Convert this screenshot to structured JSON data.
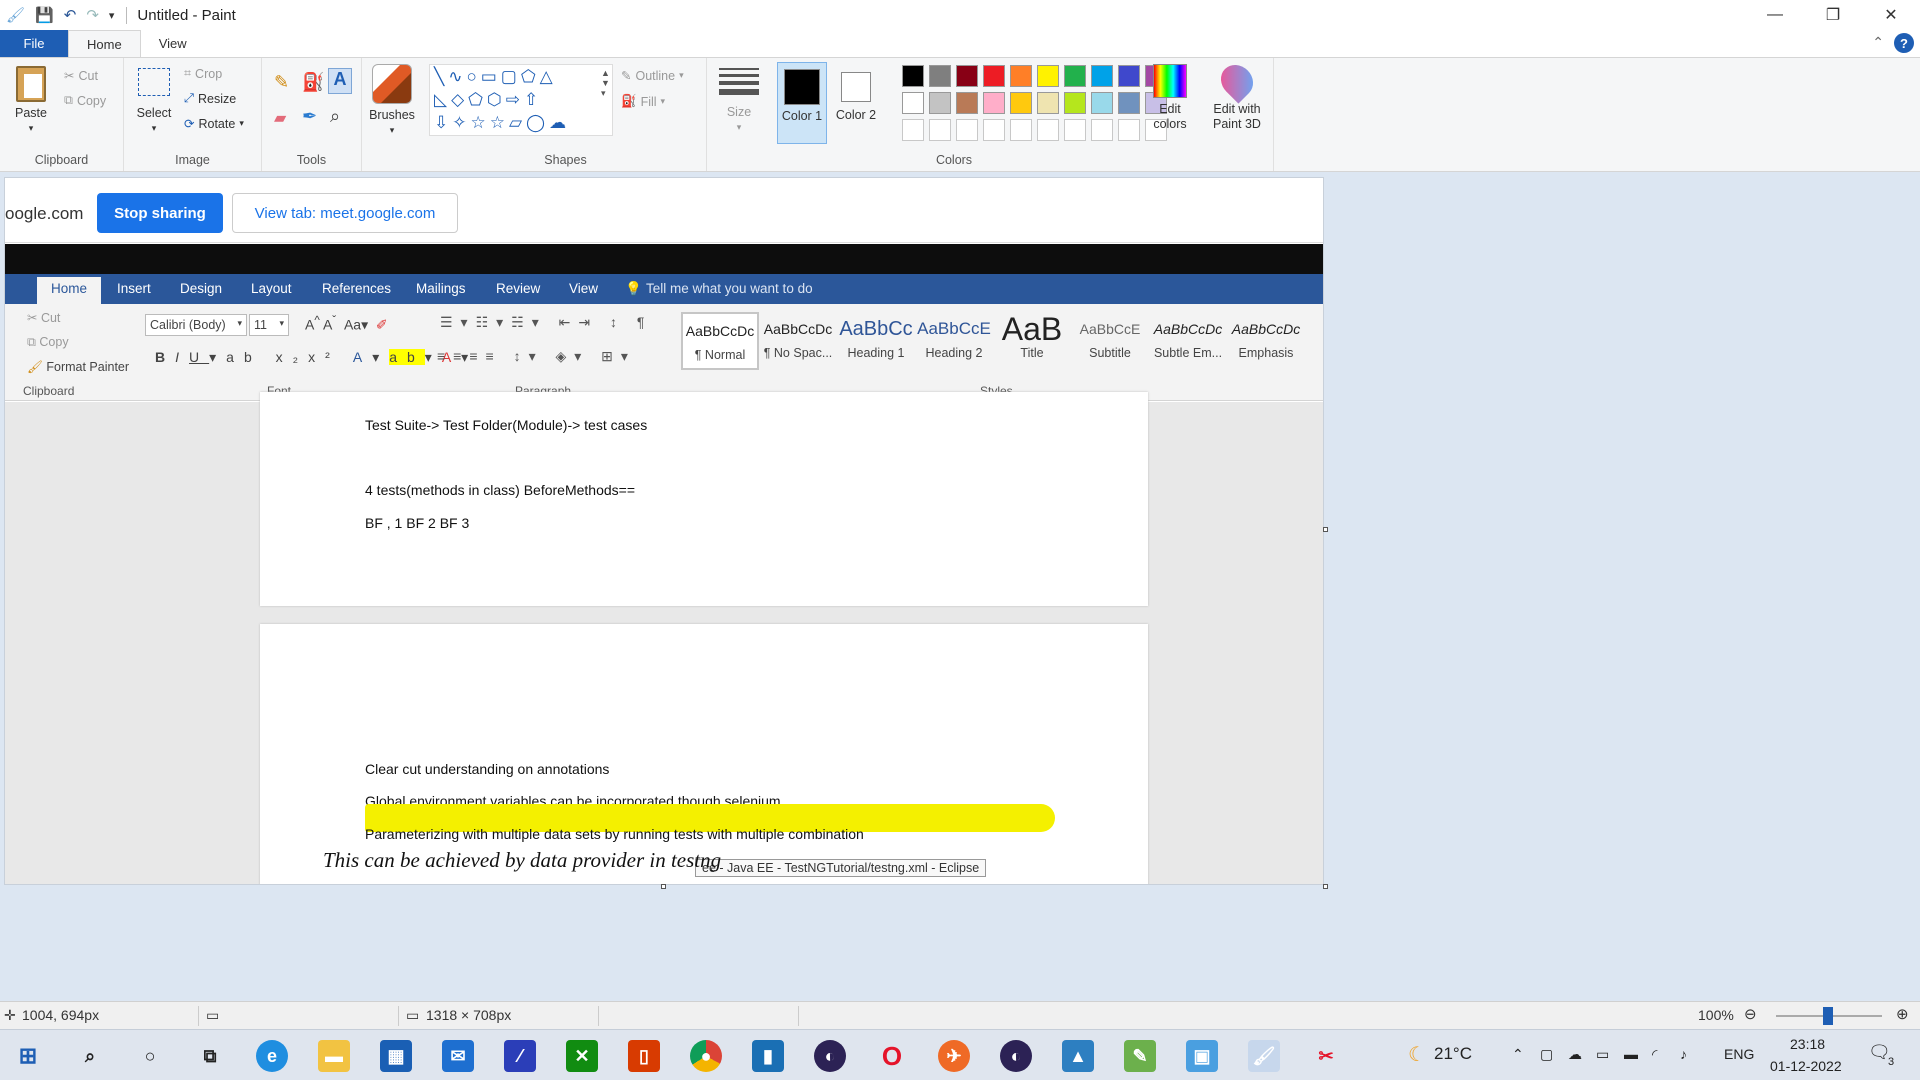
{
  "window": {
    "title": "Untitled - Paint",
    "minimize": "—",
    "restore": "❐",
    "close": "✕"
  },
  "menu": {
    "file": "File",
    "tabs": [
      "Home",
      "View"
    ],
    "help": "?"
  },
  "ribbon": {
    "clipboard": {
      "label": "Clipboard",
      "paste": "Paste",
      "cut": "Cut",
      "copy": "Copy"
    },
    "image": {
      "label": "Image",
      "select": "Select",
      "crop": "Crop",
      "resize": "Resize",
      "rotate": "Rotate"
    },
    "tools": {
      "label": "Tools"
    },
    "brushes": {
      "label": "Brushes"
    },
    "shapes": {
      "label": "Shapes",
      "outline": "Outline",
      "fill": "Fill"
    },
    "size": {
      "label": "Size"
    },
    "colors": {
      "label": "Colors",
      "color1": "Color 1",
      "color2": "Color 2",
      "edit_colors": "Edit colors",
      "edit_paint3d": "Edit with Paint 3D",
      "palette_row1": [
        "#000000",
        "#7f7f7f",
        "#880015",
        "#ed1c24",
        "#ff7f27",
        "#fff200",
        "#22b14c",
        "#00a2e8",
        "#3f48cc",
        "#a349a4"
      ],
      "palette_row2": [
        "#ffffff",
        "#c3c3c3",
        "#b97a57",
        "#ffaec9",
        "#ffc90e",
        "#efe4b0",
        "#b5e61d",
        "#99d9ea",
        "#7092be",
        "#c8bfe7"
      ]
    }
  },
  "canvas": {
    "share_bar": {
      "url": "oogle.com",
      "stop_sharing": "Stop sharing",
      "view_tab": "View tab: meet.google.com"
    },
    "word": {
      "tabs": [
        "Home",
        "Insert",
        "Design",
        "Layout",
        "References",
        "Mailings",
        "Review",
        "View"
      ],
      "tell_me": "Tell me what you want to do",
      "clipboard": {
        "label": "Clipboard",
        "cut": "Cut",
        "copy": "Copy",
        "format_painter": "Format Painter"
      },
      "font": {
        "label": "Font",
        "name": "Calibri (Body)",
        "size": "11"
      },
      "paragraph_label": "Paragraph",
      "styles_label": "Styles",
      "styles": [
        {
          "sample": "AaBbCcDc",
          "name": "¶ Normal"
        },
        {
          "sample": "AaBbCcDc",
          "name": "¶ No Spac..."
        },
        {
          "sample": "AaBbCc",
          "name": "Heading 1"
        },
        {
          "sample": "AaBbCcE",
          "name": "Heading 2"
        },
        {
          "sample": "AaB",
          "name": "Title"
        },
        {
          "sample": "AaBbCcE",
          "name": "Subtitle"
        },
        {
          "sample": "AaBbCcDc",
          "name": "Subtle Em..."
        },
        {
          "sample": "AaBbCcDc",
          "name": "Emphasis"
        }
      ],
      "page1_lines": [
        "Test Suite-> Test Folder(Module)-> test cases",
        "4 tests(methods in class) BeforeMethods==",
        "BF , 1 BF 2 BF 3"
      ],
      "page2_lines": [
        "Clear cut understanding on annotations",
        "Global environment variables can be incorporated though selenium",
        "Parameterizing with multiple data sets by running tests with multiple combination"
      ],
      "tooltip": "ee - Java EE - TestNGTutorial/testng.xml - Eclipse"
    },
    "handwritten_note": "This can be achieved by data provider in testng"
  },
  "status": {
    "cursor_pos": "1004, 694px",
    "canvas_size": "1318 × 708px",
    "zoom": "100%"
  },
  "taskbar": {
    "weather": "21°C",
    "lang": "ENG",
    "time": "23:18",
    "date": "01-12-2022",
    "notifications": "3"
  }
}
